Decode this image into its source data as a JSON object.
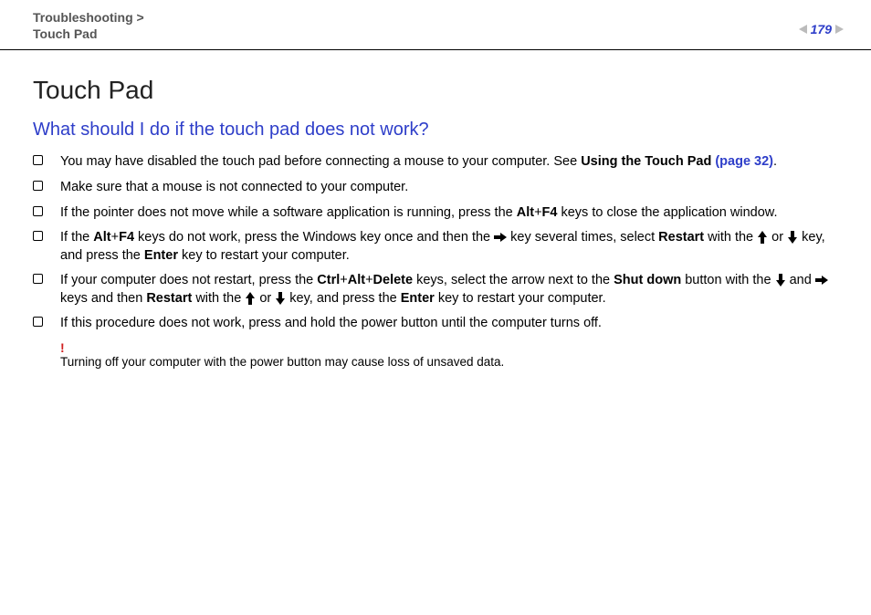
{
  "header": {
    "breadcrumb_line1": "Troubleshooting >",
    "breadcrumb_line2": "Touch Pad",
    "page_number": "179"
  },
  "title": "Touch Pad",
  "subtitle": "What should I do if the touch pad does not work?",
  "items": [
    {
      "pre": "You may have disabled the touch pad before connecting a mouse to your computer. See ",
      "bold1": "Using the Touch Pad ",
      "link": "(page 32)",
      "post": "."
    },
    {
      "text": "Make sure that a mouse is not connected to your computer."
    },
    {
      "pre": "If the pointer does not move while a software application is running, press the ",
      "b1": "Alt",
      "plus1": "+",
      "b2": "F4",
      "post": " keys to close the application window."
    },
    {
      "pre": "If the ",
      "b1": "Alt",
      "plus1": "+",
      "b2": "F4",
      "mid1": " keys do not work, press the Windows key once and then the ",
      "mid2": " key several times, select ",
      "b3": "Restart",
      "mid3": " with the ",
      "mid4": " or ",
      "mid5": " key, and press the ",
      "b4": "Enter",
      "post": " key to restart your computer."
    },
    {
      "pre": "If your computer does not restart, press the ",
      "b1": "Ctrl",
      "plus1": "+",
      "b2": "Alt",
      "plus2": "+",
      "b3": "Delete",
      "mid1": " keys, select the arrow next to the ",
      "b4": "Shut down",
      "mid2": " button with the ",
      "mid3": " and ",
      "mid4": " keys and then ",
      "b5": "Restart",
      "mid5": " with the ",
      "mid6": " or ",
      "mid7": " key, and press the ",
      "b6": "Enter",
      "post": " key to restart your computer."
    },
    {
      "text": "If this procedure does not work, press and hold the power button until the computer turns off."
    }
  ],
  "warning": {
    "mark": "!",
    "text": "Turning off your computer with the power button may cause loss of unsaved data."
  }
}
